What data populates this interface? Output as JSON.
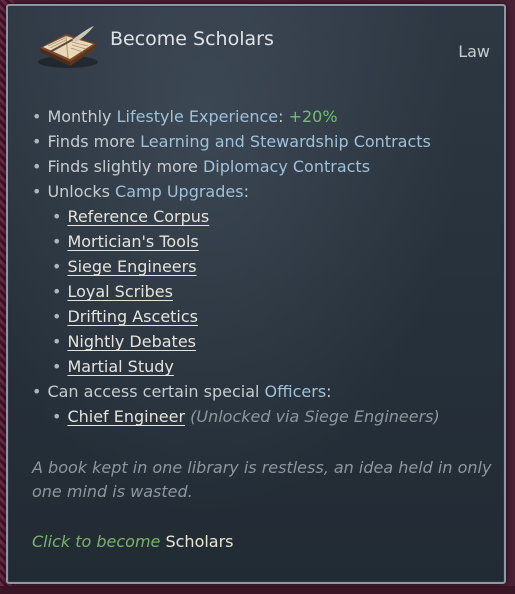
{
  "header": {
    "title": "Become Scholars",
    "law_label": "Law",
    "icon": "book-quill-icon"
  },
  "effects": {
    "lifestyle_label": "Monthly ",
    "lifestyle_hl": "Lifestyle Experience",
    "lifestyle_colon": ": ",
    "lifestyle_value": "+20%",
    "learning_prefix": "Finds more ",
    "learning_hl": "Learning and Stewardship Contracts",
    "diplomacy_prefix": "Finds slightly more ",
    "diplomacy_hl": "Diplomacy Contracts",
    "unlocks_prefix": "Unlocks ",
    "unlocks_hl": "Camp Upgrades",
    "unlocks_suffix": ":",
    "upgrades": [
      "Reference Corpus",
      "Mortician's Tools",
      "Siege Engineers",
      "Loyal Scribes",
      "Drifting Ascetics",
      "Nightly Debates",
      "Martial Study"
    ],
    "officers_prefix": "Can access certain special ",
    "officers_hl": "Officers",
    "officers_suffix": ":",
    "officer_name": "Chief Engineer",
    "officer_note": "(Unlocked via Siege Engineers)"
  },
  "flavor_text": "A book kept in one library is restless, an idea held in only one mind is wasted.",
  "action": {
    "prefix": "Click to become ",
    "target": "Scholars"
  },
  "colors": {
    "highlight_blue": "#9fc1d9",
    "positive_green": "#6ec26a",
    "border": "#8d98a6"
  }
}
